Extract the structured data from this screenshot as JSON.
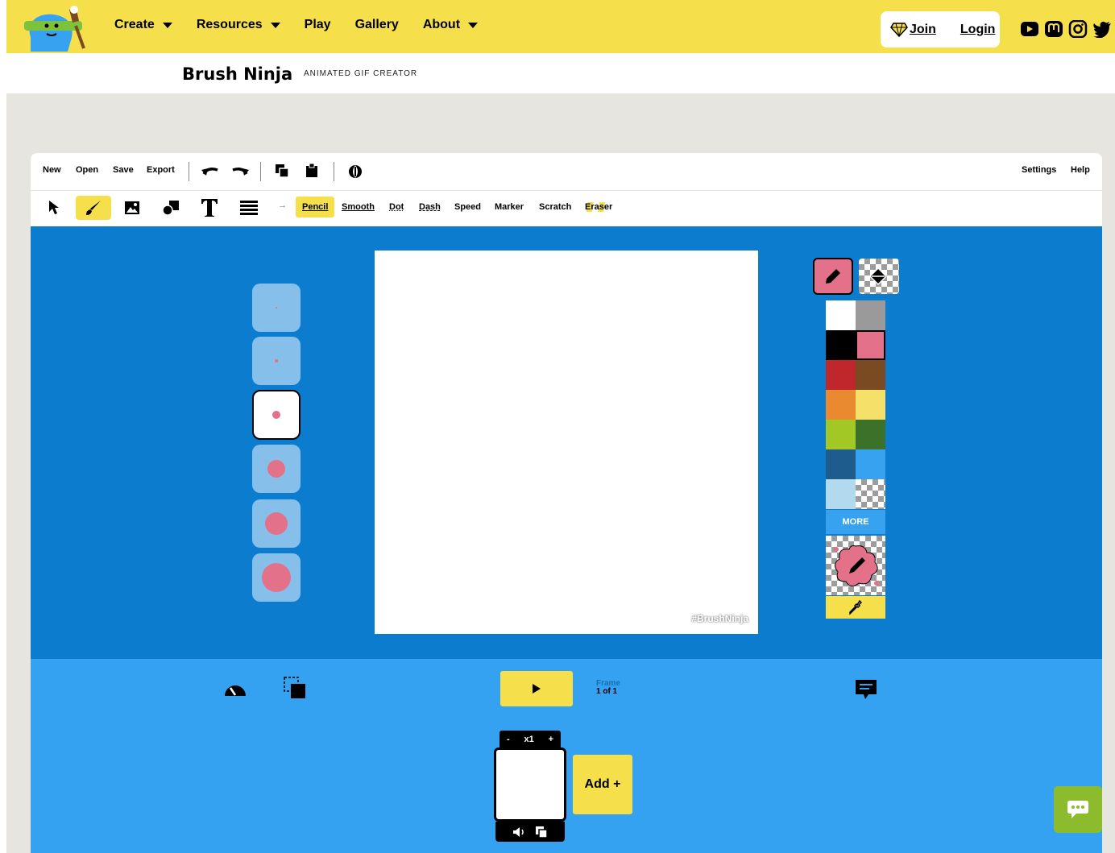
{
  "nav": {
    "items": [
      {
        "label": "Create",
        "has_caret": true
      },
      {
        "label": "Resources",
        "has_caret": true
      },
      {
        "label": "Play",
        "has_caret": false
      },
      {
        "label": "Gallery",
        "has_caret": false
      },
      {
        "label": "About",
        "has_caret": true
      }
    ],
    "join_label": "Join",
    "login_label": "Login",
    "social_icons": [
      "youtube-icon",
      "mastodon-icon",
      "instagram-icon",
      "twitter-icon"
    ],
    "bg_color": "#f5e04c"
  },
  "brand": {
    "name": "Brush Ninja",
    "subtitle": "ANIMATED GIF CREATOR"
  },
  "menubar": {
    "new": "New",
    "open": "Open",
    "save": "Save",
    "export": "Export",
    "settings": "Settings",
    "help": "Help",
    "icons": [
      "undo-icon",
      "redo-icon",
      "copy-icon",
      "paste-icon",
      "onion-skin-icon"
    ]
  },
  "toolbar": {
    "tools": [
      "select-icon",
      "brush-icon",
      "image-icon",
      "shapes-icon",
      "text-icon",
      "lines-icon"
    ],
    "active_tool": "brush",
    "brush_options": [
      "Pencil",
      "Smooth",
      "Dot",
      "Dash",
      "Speed",
      "Marker",
      "Scratch",
      "Eraser"
    ],
    "active_brush": "Pencil"
  },
  "canvas": {
    "watermark": "#BrushNinja"
  },
  "brush_sizes": {
    "selected_index": 2,
    "count": 6
  },
  "palette": {
    "stroke_color": "#e3718a",
    "colors": [
      "#ffffff",
      "#9a9a9a",
      "#000000",
      "#e3718a",
      "#c0272d",
      "#7a4a22",
      "#ea8a30",
      "#f5e06a",
      "#a1c825",
      "#3b7129",
      "#1d5c8c",
      "#36a2f0",
      "#b2d9ee",
      "transparent"
    ],
    "selected_color": "#e3718a",
    "more_label": "MORE"
  },
  "playback": {
    "frame_label": "Frame",
    "frame_value": "1 of 1",
    "frame_multiplier": "x1",
    "minus": "-",
    "plus": "+",
    "add_label": "Add +"
  },
  "colors": {
    "stage_bg": "#0c7ccf",
    "bottom_bg": "#34a2f0",
    "accent": "#f5e04c",
    "backdrop": "#e6e5df",
    "chat_fab": "#8cbc2d"
  }
}
